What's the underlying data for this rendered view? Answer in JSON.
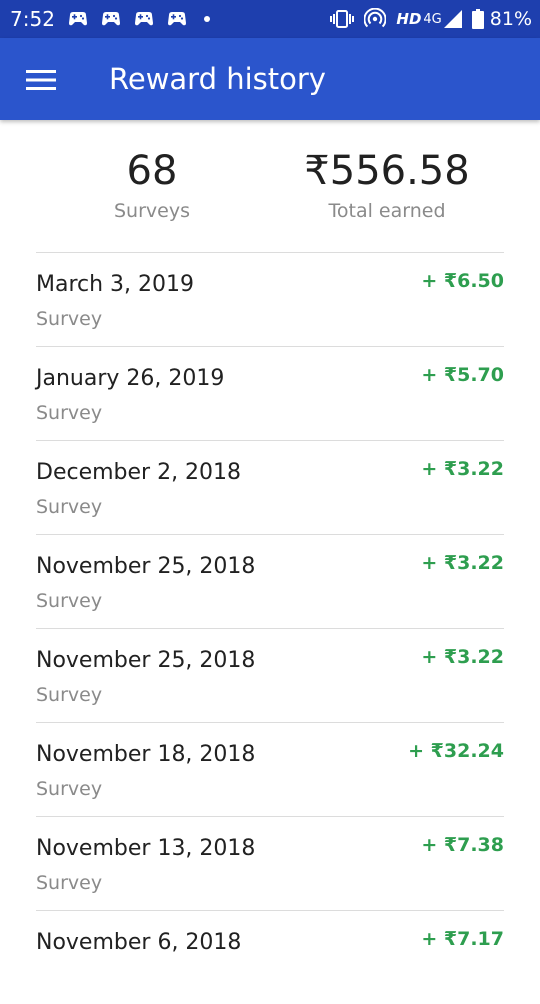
{
  "status_bar": {
    "time": "7:52",
    "hd_label": "HD",
    "network_label": "4G",
    "battery_percent": "81%"
  },
  "app_bar": {
    "title": "Reward history",
    "background_color": "#2b55cc"
  },
  "summary": {
    "surveys_count": "68",
    "surveys_label": "Surveys",
    "total_earned": "₹556.58",
    "total_label": "Total earned"
  },
  "amount_color": "#2e9e4f",
  "history": [
    {
      "date": "March 3, 2019",
      "type": "Survey",
      "amount": "+ ₹6.50"
    },
    {
      "date": "January 26, 2019",
      "type": "Survey",
      "amount": "+ ₹5.70"
    },
    {
      "date": "December 2, 2018",
      "type": "Survey",
      "amount": "+ ₹3.22"
    },
    {
      "date": "November 25, 2018",
      "type": "Survey",
      "amount": "+ ₹3.22"
    },
    {
      "date": "November 25, 2018",
      "type": "Survey",
      "amount": "+ ₹3.22"
    },
    {
      "date": "November 18, 2018",
      "type": "Survey",
      "amount": "+ ₹32.24"
    },
    {
      "date": "November 13, 2018",
      "type": "Survey",
      "amount": "+ ₹7.38"
    },
    {
      "date": "November 6, 2018",
      "type": "",
      "amount": "+ ₹7.17"
    }
  ]
}
